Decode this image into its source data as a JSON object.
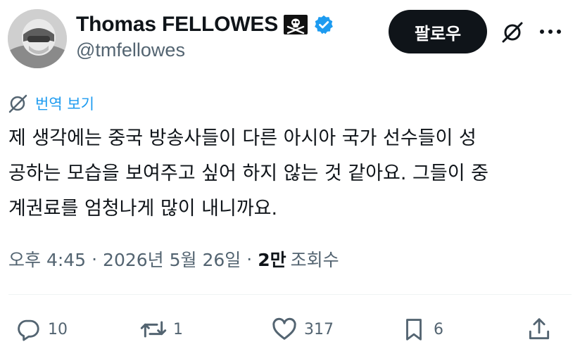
{
  "author": {
    "display_name": "Thomas FELLOWES",
    "handle": "@tmfellowes",
    "badges": [
      "skull-crossbones-icon",
      "verified-badge-icon"
    ]
  },
  "header": {
    "follow_label": "팔로우",
    "icons": [
      "grok-icon",
      "more-icon"
    ]
  },
  "translate": {
    "label": "번역 보기",
    "icon": "translate-icon",
    "color": "#1d9bf0"
  },
  "tweet": {
    "lines": [
      "제 생각에는 중국 방송사들이 다른 아시아 국가 선수들이 성",
      "공하는 모습을 보여주고 싶어 하지 않는 것 같아요. 그들이 중",
      "계권료를 엄청나게 많이 내니까요."
    ]
  },
  "meta": {
    "time": "오후 4:45",
    "separator": "·",
    "date": "2026년 5월 26일",
    "views_count": "2만",
    "views_label": "조회수"
  },
  "actions": {
    "reply": {
      "icon": "reply-icon",
      "count": "10"
    },
    "retweet": {
      "icon": "retweet-icon",
      "count": "1"
    },
    "like": {
      "icon": "heart-icon",
      "count": "317"
    },
    "bookmark": {
      "icon": "bookmark-icon",
      "count": "6"
    },
    "share": {
      "icon": "share-icon"
    }
  },
  "colors": {
    "text_primary": "#0f1419",
    "text_secondary": "#536471",
    "accent": "#1d9bf0",
    "verified": "#1d9bf0",
    "follow_button_bg": "#0f1419"
  }
}
